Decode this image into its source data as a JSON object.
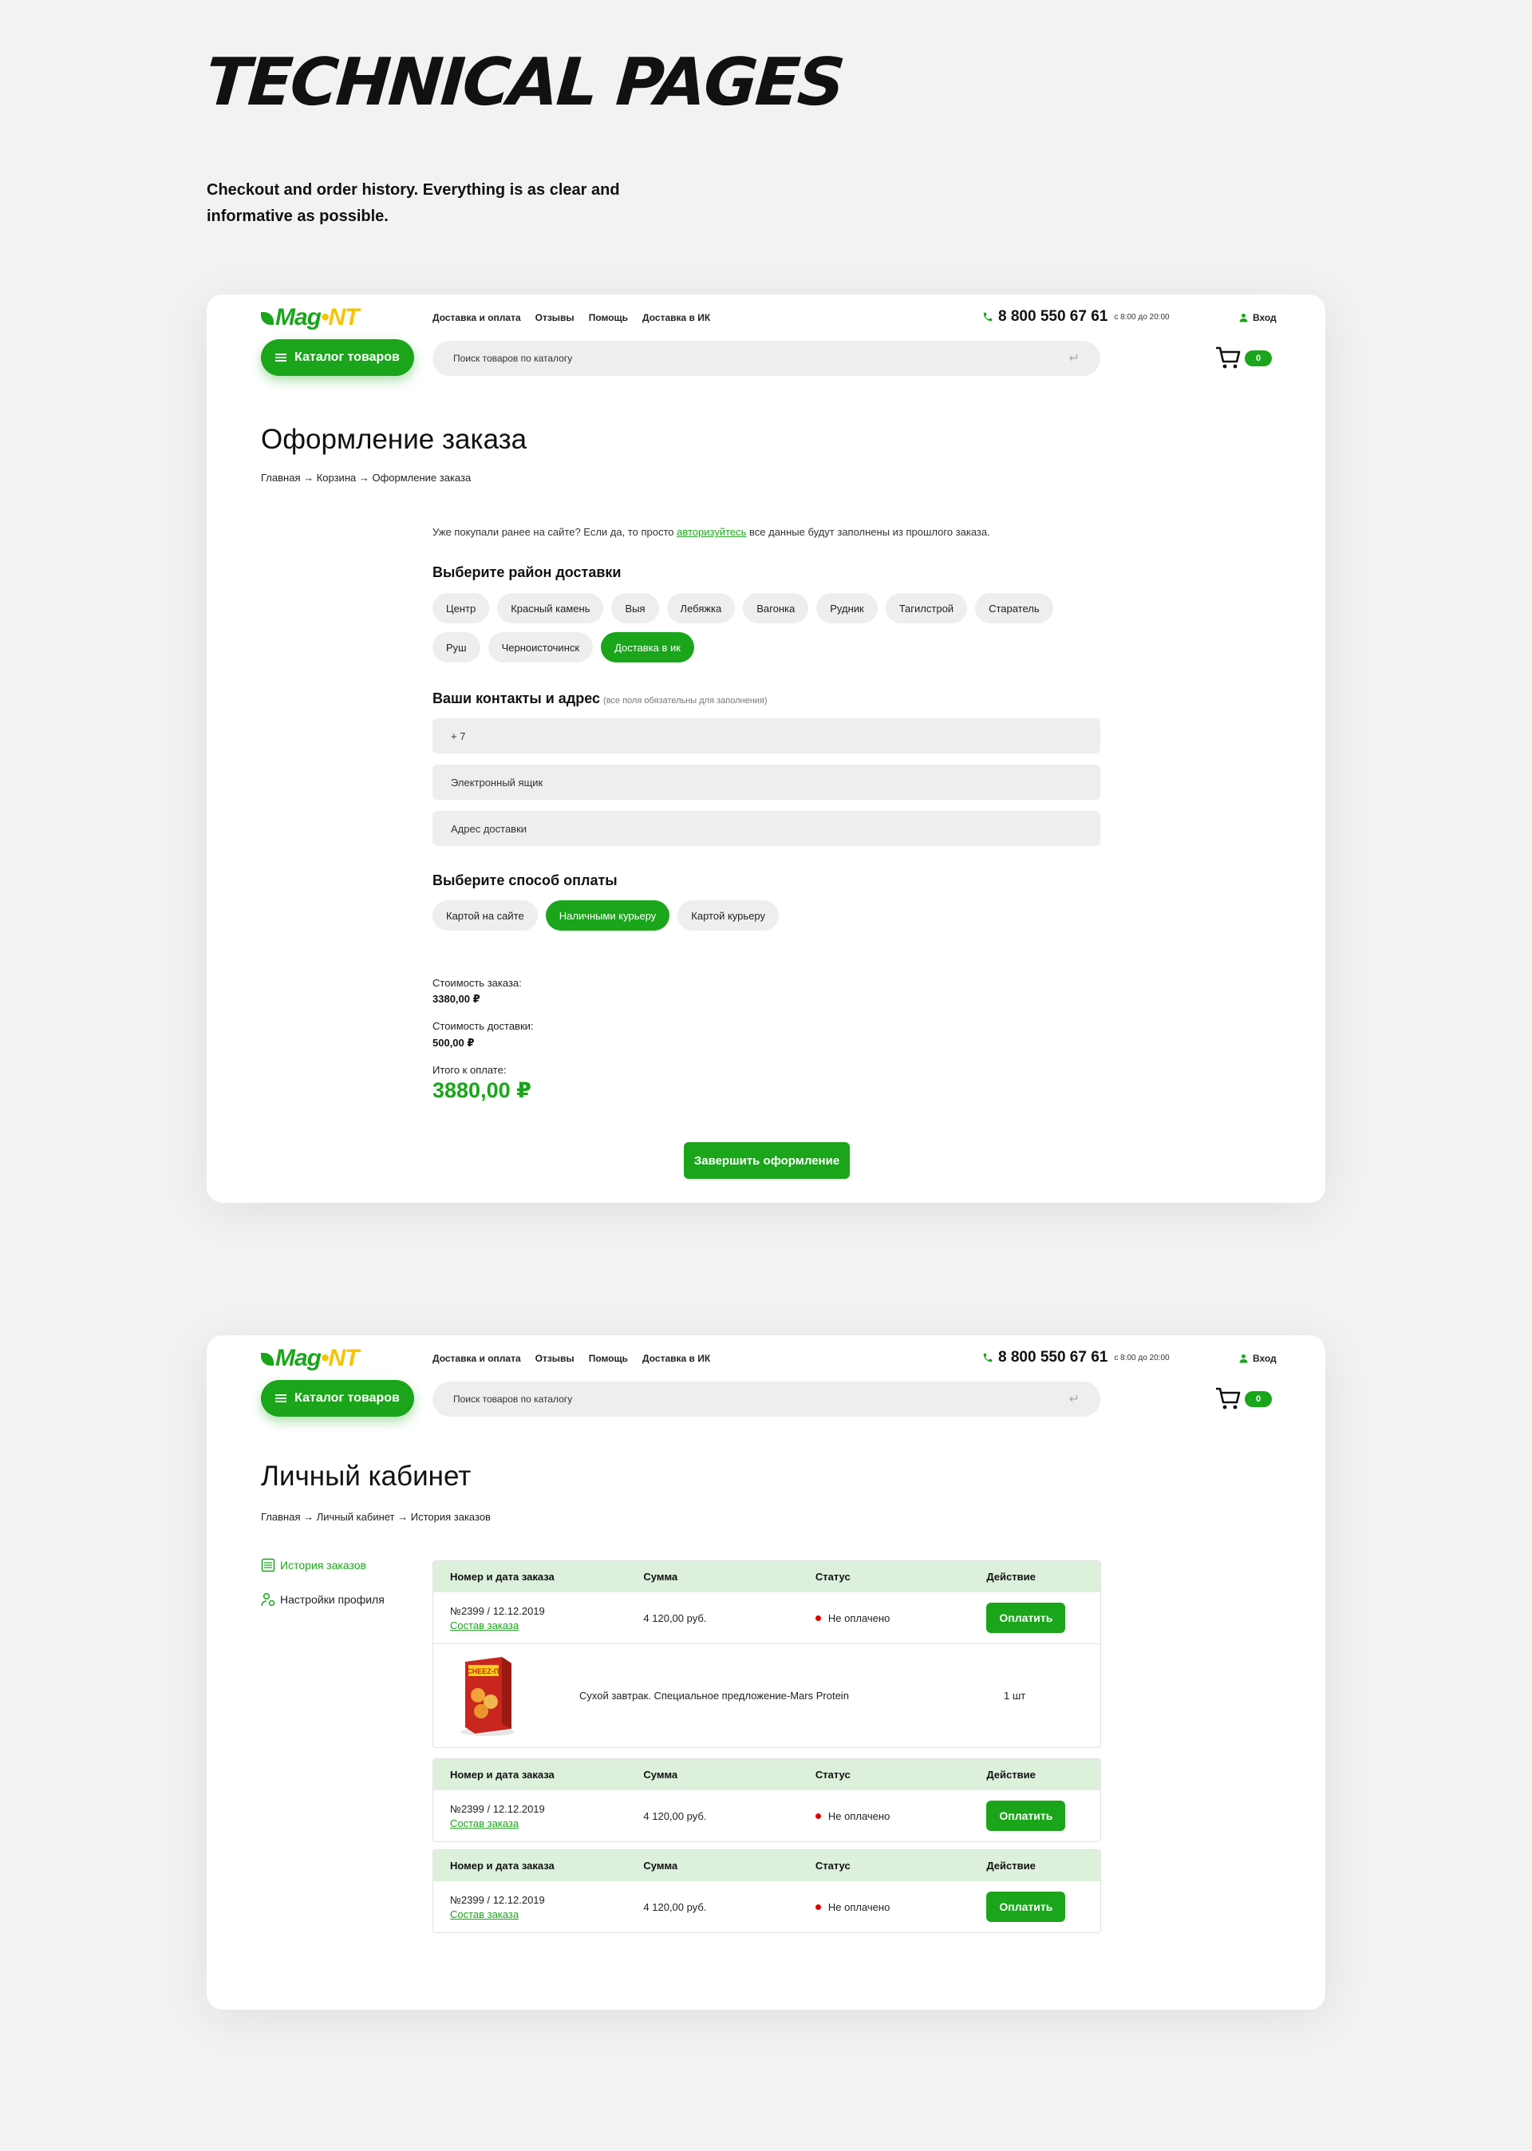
{
  "intro": {
    "title": "TECHNICAL PAGES",
    "description": "Checkout and order history. Everything is as clear and informative as possible."
  },
  "header": {
    "logo_main": "Mag",
    "logo_accent": "•NT",
    "nav": [
      "Доставка и оплата",
      "Отзывы",
      "Помощь",
      "Доставка в ИК"
    ],
    "phone": "8 800 550 67 61",
    "hours": "с 8:00 до 20:00",
    "login": "Вход",
    "catalog": "Каталог товаров",
    "search_placeholder": "Поиск товаров по каталогу",
    "cart_count": "0",
    "accent_color": "#1aa51a"
  },
  "checkout": {
    "title": "Оформление заказа",
    "breadcrumb": "Главная → Корзина → Оформление заказа",
    "hint_before": "Уже покупали ранее на сайте? Если да, то просто ",
    "hint_link": "авторизуйтесь",
    "hint_after": " все данные будут заполнены из прошлого заказа.",
    "district_title": "Выберите район доставки",
    "districts": [
      {
        "label": "Центр",
        "active": false
      },
      {
        "label": "Красный камень",
        "active": false
      },
      {
        "label": "Выя",
        "active": false
      },
      {
        "label": "Лебяжка",
        "active": false
      },
      {
        "label": "Вагонка",
        "active": false
      },
      {
        "label": "Рудник",
        "active": false
      },
      {
        "label": "Тагилстрой",
        "active": false
      },
      {
        "label": "Старатель",
        "active": false
      },
      {
        "label": "Руш",
        "active": false
      },
      {
        "label": "Черноисточинск",
        "active": false
      },
      {
        "label": "Доставка в ик",
        "active": true
      }
    ],
    "contacts_title": "Ваши контакты и адрес",
    "contacts_note": "(все поля обязательны для заполнения)",
    "phone_value": "+ 7",
    "email_placeholder": "Электронный ящик",
    "address_placeholder": "Адрес доставки",
    "payment_title": "Выберите способ оплаты",
    "payments": [
      {
        "label": "Картой на сайте",
        "active": false
      },
      {
        "label": "Наличными курьеру",
        "active": true
      },
      {
        "label": "Картой курьеру",
        "active": false
      }
    ],
    "order_cost_label": "Стоимость заказа:",
    "order_cost": "3380,00 ₽",
    "delivery_cost_label": "Стоимость доставки:",
    "delivery_cost": "500,00 ₽",
    "total_label": "Итого к оплате:",
    "total": "3880,00 ₽",
    "finish": "Завершить оформление"
  },
  "account": {
    "title": "Личный кабинет",
    "breadcrumb": "Главная → Личный кабинет → История заказов",
    "menu": [
      {
        "label": "История заказов",
        "active": true,
        "icon": "history-icon"
      },
      {
        "label": "Настройки профиля",
        "active": false,
        "icon": "profile-settings-icon"
      }
    ],
    "columns": [
      "Номер и дата заказа",
      "Сумма",
      "Статус",
      "Действие"
    ],
    "orders": [
      {
        "number": "№2399 / 12.12.2019",
        "link": "Состав заказа",
        "sum": "4 120,00 руб.",
        "status": "Не оплачено",
        "action": "Оплатить",
        "item": {
          "name": "Сухой завтрак. Специальное предложение-Mars Protein",
          "qty": "1 шт",
          "brand": "CHEEZ-IT"
        }
      },
      {
        "number": "№2399 / 12.12.2019",
        "link": "Состав заказа",
        "sum": "4 120,00 руб.",
        "status": "Не оплачено",
        "action": "Оплатить"
      },
      {
        "number": "№2399 / 12.12.2019",
        "link": "Состав заказа",
        "sum": "4 120,00 руб.",
        "status": "Не оплачено",
        "action": "Оплатить"
      }
    ]
  }
}
